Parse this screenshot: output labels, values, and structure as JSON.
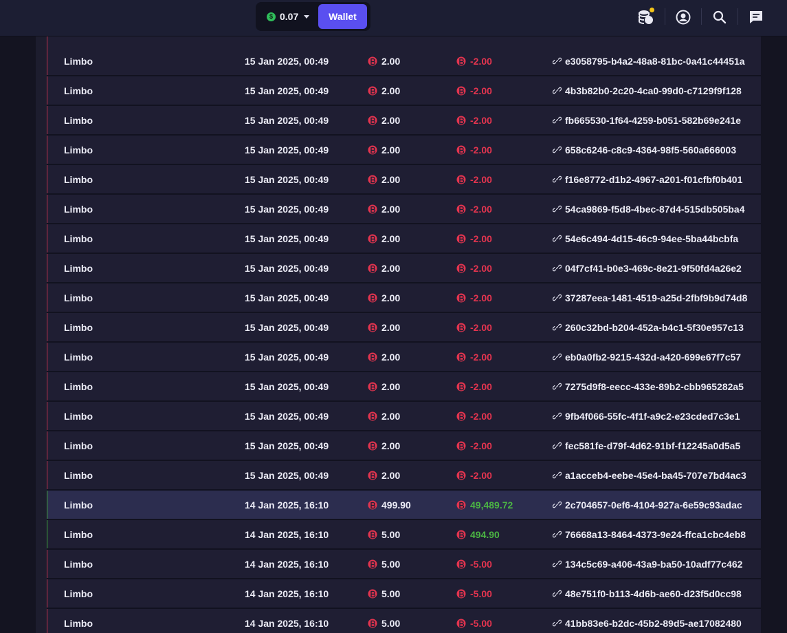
{
  "header": {
    "balance": "0.07",
    "currency_icon": "dollar-coin-icon",
    "wallet_label": "Wallet",
    "colors": {
      "wallet_button": "#5a4ff0",
      "bar": "#1c1e33",
      "notification_dot": "#f5c518"
    },
    "icons": [
      "coins-stack-icon",
      "user-profile-icon",
      "search-icon",
      "chat-icon"
    ]
  },
  "table": {
    "colors": {
      "loss": "#e3344f",
      "win": "#4bb543",
      "row": "#1f1e33",
      "row_highlight": "#2c2d4f"
    },
    "rows": [
      {
        "game": "Limbo",
        "date": "15 Jan 2025, 00:49",
        "bet": "2.00",
        "payout": "-2.00",
        "result": "loss",
        "id": "e3058795-b4a2-48a8-81bc-0a41c44451a"
      },
      {
        "game": "Limbo",
        "date": "15 Jan 2025, 00:49",
        "bet": "2.00",
        "payout": "-2.00",
        "result": "loss",
        "id": "4b3b82b0-2c20-4ca0-99d0-c7129f9f128"
      },
      {
        "game": "Limbo",
        "date": "15 Jan 2025, 00:49",
        "bet": "2.00",
        "payout": "-2.00",
        "result": "loss",
        "id": "fb665530-1f64-4259-b051-582b69e241e"
      },
      {
        "game": "Limbo",
        "date": "15 Jan 2025, 00:49",
        "bet": "2.00",
        "payout": "-2.00",
        "result": "loss",
        "id": "658c6246-c8c9-4364-98f5-560a666003"
      },
      {
        "game": "Limbo",
        "date": "15 Jan 2025, 00:49",
        "bet": "2.00",
        "payout": "-2.00",
        "result": "loss",
        "id": "f16e8772-d1b2-4967-a201-f01cfbf0b401"
      },
      {
        "game": "Limbo",
        "date": "15 Jan 2025, 00:49",
        "bet": "2.00",
        "payout": "-2.00",
        "result": "loss",
        "id": "54ca9869-f5d8-4bec-87d4-515db505ba4"
      },
      {
        "game": "Limbo",
        "date": "15 Jan 2025, 00:49",
        "bet": "2.00",
        "payout": "-2.00",
        "result": "loss",
        "id": "54e6c494-4d15-46c9-94ee-5ba44bcbfa"
      },
      {
        "game": "Limbo",
        "date": "15 Jan 2025, 00:49",
        "bet": "2.00",
        "payout": "-2.00",
        "result": "loss",
        "id": "04f7cf41-b0e3-469c-8e21-9f50fd4a26e2"
      },
      {
        "game": "Limbo",
        "date": "15 Jan 2025, 00:49",
        "bet": "2.00",
        "payout": "-2.00",
        "result": "loss",
        "id": "37287eea-1481-4519-a25d-2fbf9b9d74d8"
      },
      {
        "game": "Limbo",
        "date": "15 Jan 2025, 00:49",
        "bet": "2.00",
        "payout": "-2.00",
        "result": "loss",
        "id": "260c32bd-b204-452a-b4c1-5f30e957c13"
      },
      {
        "game": "Limbo",
        "date": "15 Jan 2025, 00:49",
        "bet": "2.00",
        "payout": "-2.00",
        "result": "loss",
        "id": "eb0a0fb2-9215-432d-a420-699e67f7c57"
      },
      {
        "game": "Limbo",
        "date": "15 Jan 2025, 00:49",
        "bet": "2.00",
        "payout": "-2.00",
        "result": "loss",
        "id": "7275d9f8-eecc-433e-89b2-cbb965282a5"
      },
      {
        "game": "Limbo",
        "date": "15 Jan 2025, 00:49",
        "bet": "2.00",
        "payout": "-2.00",
        "result": "loss",
        "id": "9fb4f066-55fc-4f1f-a9c2-e23cded7c3e1"
      },
      {
        "game": "Limbo",
        "date": "15 Jan 2025, 00:49",
        "bet": "2.00",
        "payout": "-2.00",
        "result": "loss",
        "id": "fec581fe-d79f-4d62-91bf-f12245a0d5a5"
      },
      {
        "game": "Limbo",
        "date": "15 Jan 2025, 00:49",
        "bet": "2.00",
        "payout": "-2.00",
        "result": "loss",
        "id": "a1acceb4-eebe-45e4-ba45-707e7bd4ac3"
      },
      {
        "game": "Limbo",
        "date": "14 Jan 2025, 16:10",
        "bet": "499.90",
        "payout": "49,489.72",
        "result": "win",
        "highlight": true,
        "id": "2c704657-0ef6-4104-927a-6e59c93adac"
      },
      {
        "game": "Limbo",
        "date": "14 Jan 2025, 16:10",
        "bet": "5.00",
        "payout": "494.90",
        "result": "win",
        "id": "76668a13-8464-4373-9e24-ffca1cbc4eb8"
      },
      {
        "game": "Limbo",
        "date": "14 Jan 2025, 16:10",
        "bet": "5.00",
        "payout": "-5.00",
        "result": "loss",
        "id": "134c5c69-a406-43a9-ba50-10adf77c462"
      },
      {
        "game": "Limbo",
        "date": "14 Jan 2025, 16:10",
        "bet": "5.00",
        "payout": "-5.00",
        "result": "loss",
        "id": "48e751f0-b113-4d6b-ae60-d23f5d0cc98"
      },
      {
        "game": "Limbo",
        "date": "14 Jan 2025, 16:10",
        "bet": "5.00",
        "payout": "-5.00",
        "result": "loss",
        "id": "41bb83e6-b2dc-45b2-89d5-ae17082480"
      }
    ]
  }
}
